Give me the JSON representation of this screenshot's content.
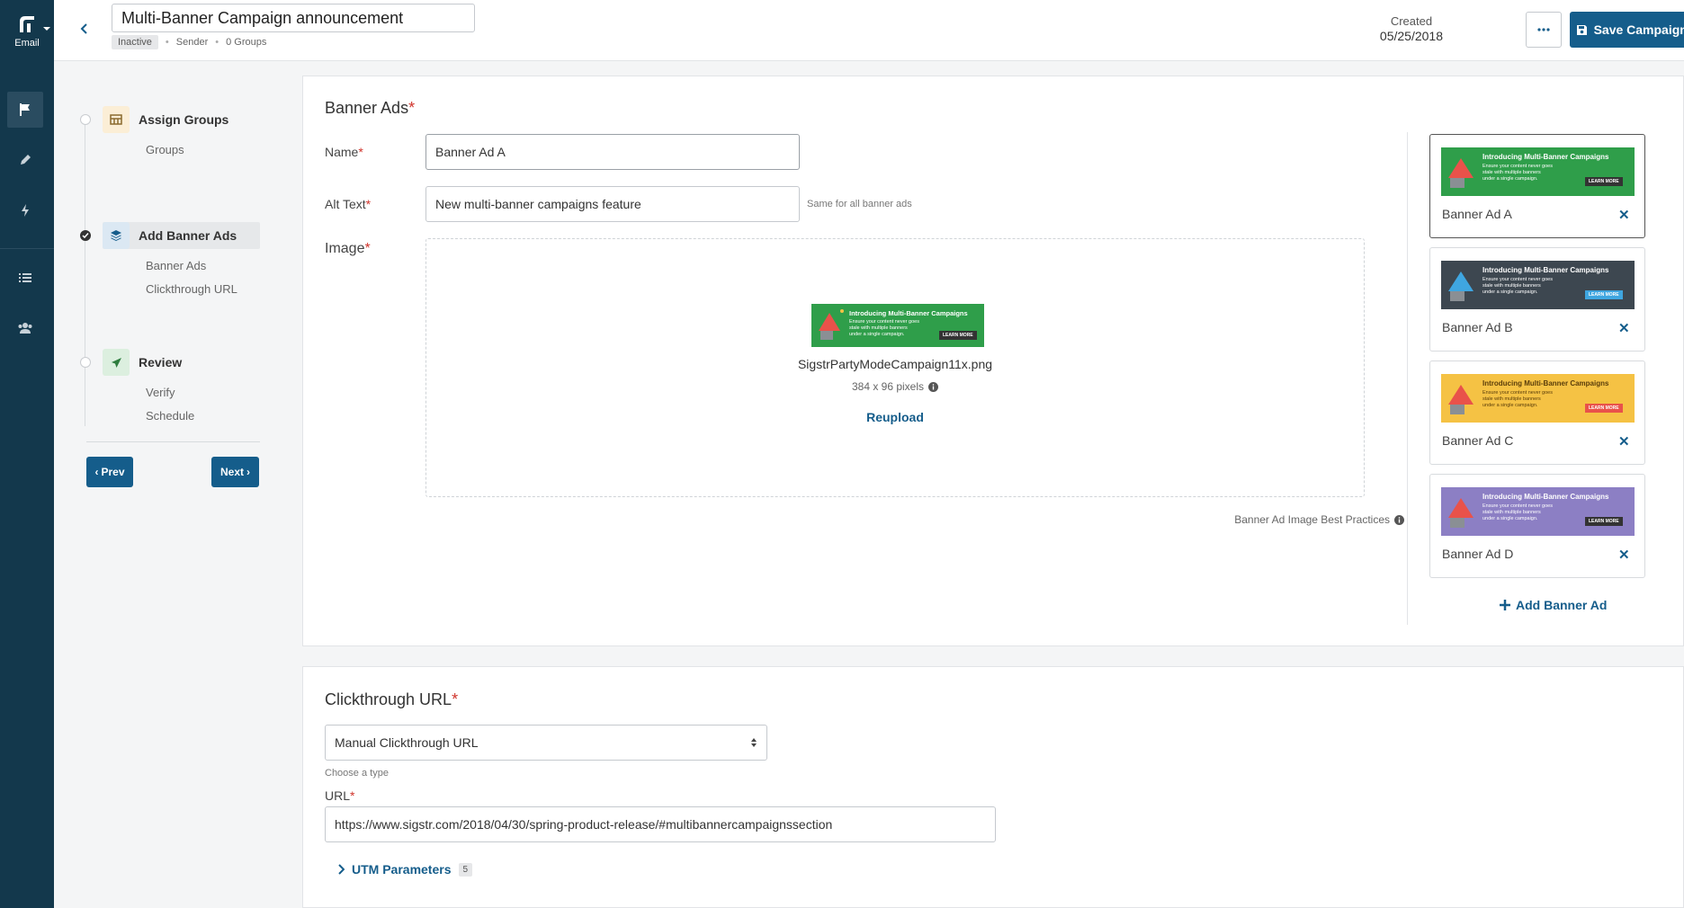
{
  "rail": {
    "logo_label": "Email"
  },
  "header": {
    "title_value": "Multi-Banner Campaign announcement",
    "status": "Inactive",
    "sender": "Sender",
    "groups": "0 Groups",
    "created_label": "Created",
    "created_date": "05/25/2018",
    "save_label": "Save Campaign & Exit"
  },
  "steps": [
    {
      "title": "Assign Groups",
      "subs": [
        "Groups"
      ]
    },
    {
      "title": "Add Banner Ads",
      "subs": [
        "Banner Ads",
        "Clickthrough URL"
      ]
    },
    {
      "title": "Review",
      "subs": [
        "Verify",
        "Schedule"
      ]
    }
  ],
  "nav": {
    "prev": "Prev",
    "next": "Next"
  },
  "banner_ads": {
    "heading": "Banner Ads",
    "name_label": "Name",
    "name_value": "Banner Ad A",
    "alt_label": "Alt Text",
    "alt_value": "New multi-banner campaigns feature",
    "alt_hint": "Same for all banner ads",
    "image_label": "Image",
    "filename": "SigstrPartyModeCampaign11x.png",
    "dimensions": "384 x 96 pixels",
    "reupload": "Reupload",
    "best_practices": "Banner Ad Image Best Practices",
    "banner_text": {
      "title": "Introducing Multi-Banner Campaigns",
      "line1": "Ensure your content never goes",
      "line2": "stale with multiple banners",
      "line3": "under a single campaign.",
      "cta": "LEARN MORE"
    },
    "ads": [
      {
        "name": "Banner Ad A",
        "color": "#2f9e4a"
      },
      {
        "name": "Banner Ad B",
        "color": "#3d4750"
      },
      {
        "name": "Banner Ad C",
        "color": "#f5c244"
      },
      {
        "name": "Banner Ad D",
        "color": "#8c7fc4"
      }
    ],
    "add_label": "Add Banner Ad"
  },
  "clickthrough": {
    "heading": "Clickthrough URL",
    "type_value": "Manual Clickthrough URL",
    "type_hint": "Choose a type",
    "url_label": "URL",
    "url_value": "https://www.sigstr.com/2018/04/30/spring-product-release/#multibannercampaignssection",
    "utm_label": "UTM Parameters",
    "utm_count": "5"
  },
  "colors": {
    "primary": "#155d8b",
    "rail": "#13384c",
    "required": "#d0342c"
  }
}
